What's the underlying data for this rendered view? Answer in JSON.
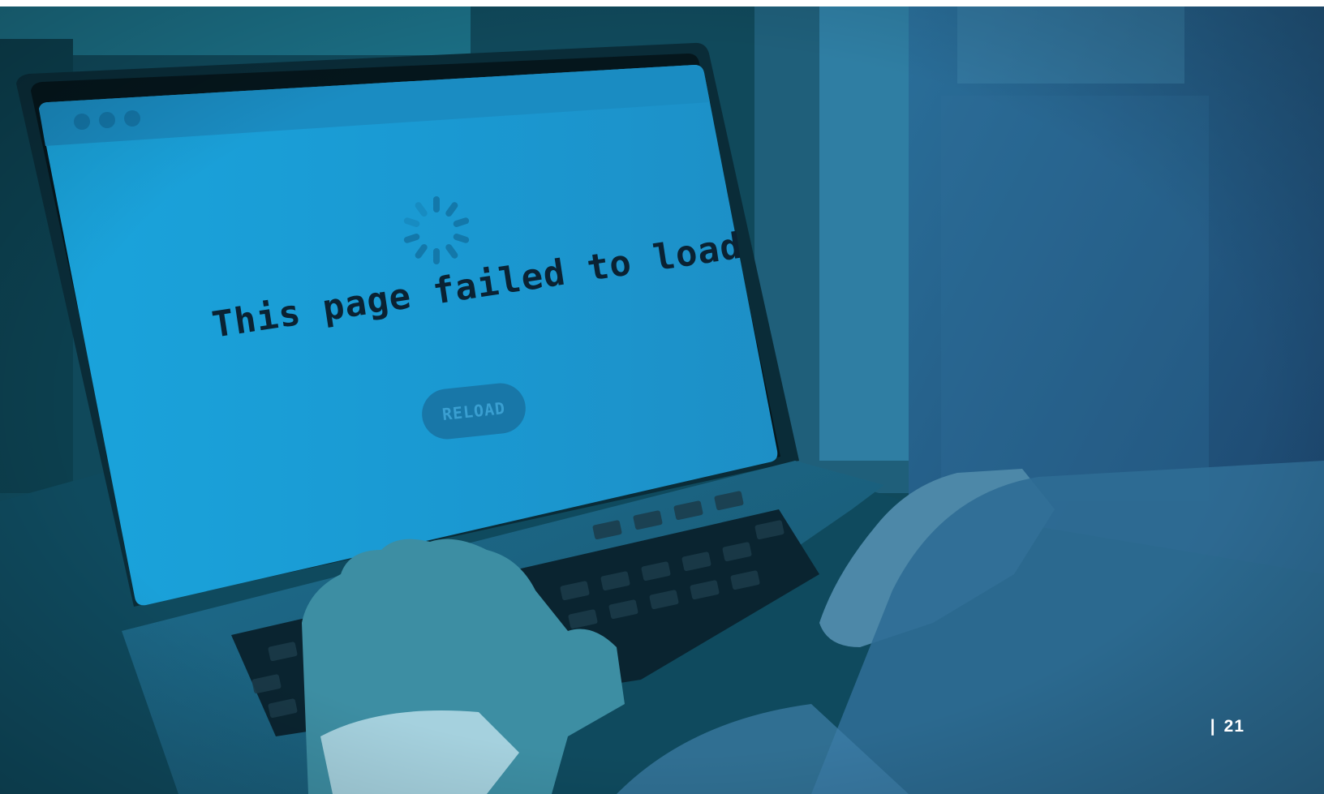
{
  "image": {
    "subject": "hands typing on a laptop showing a page load error",
    "tint_color": "#1a6a96"
  },
  "screen": {
    "message": "This page failed to load",
    "reload_label": "RELOAD",
    "loading_icon": "spinner-icon",
    "window_dots": 3
  },
  "footer": {
    "separator": "|",
    "page_number": "21"
  }
}
